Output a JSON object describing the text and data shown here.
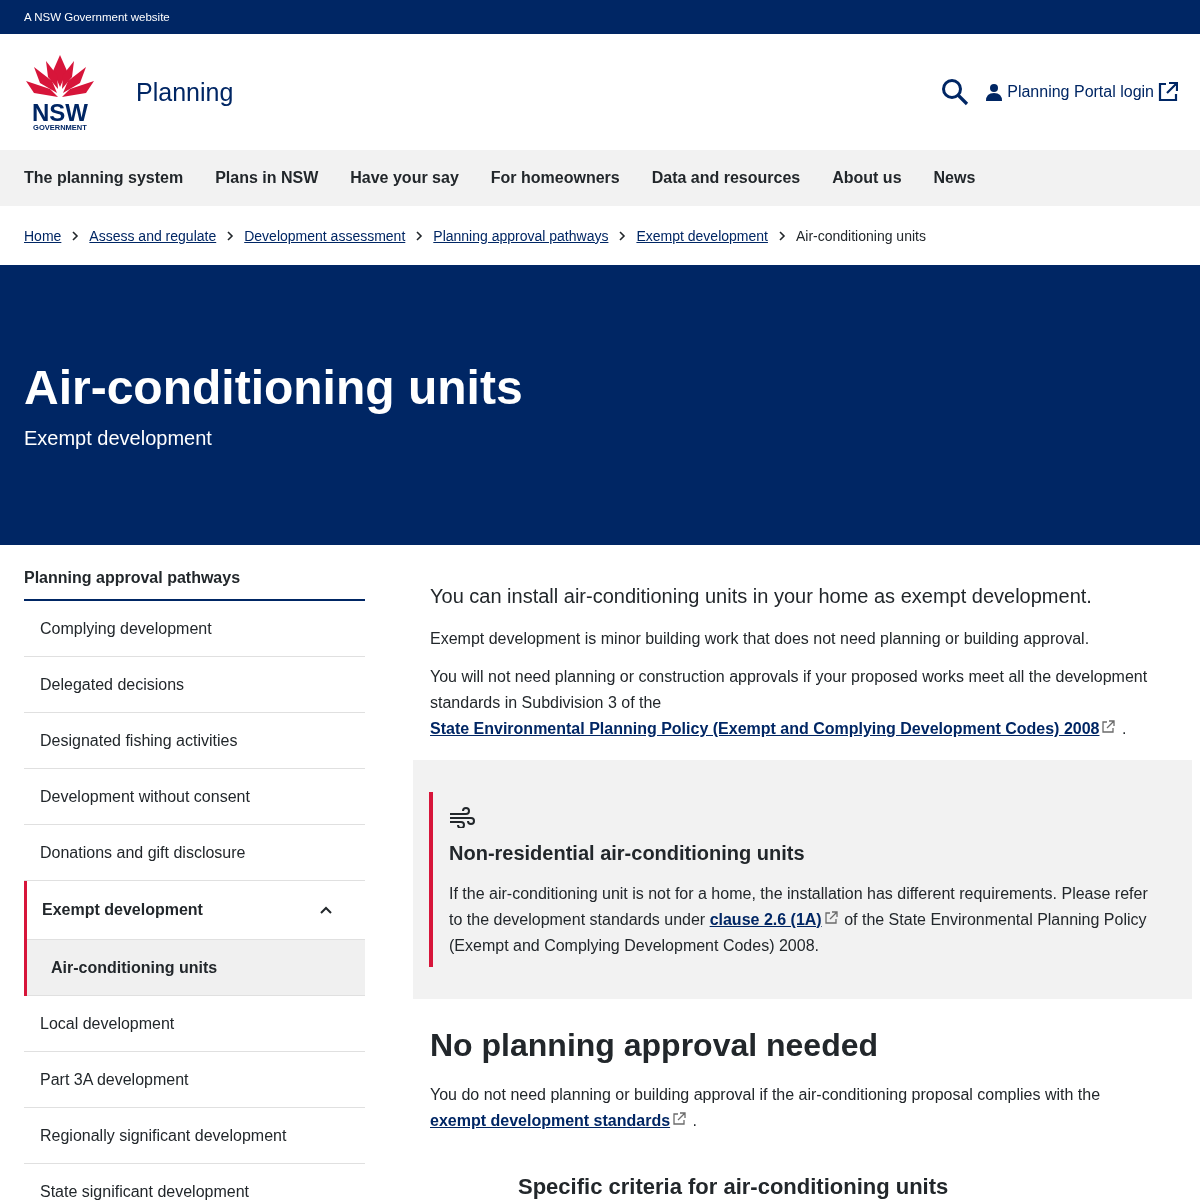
{
  "masthead": {
    "text": "A NSW Government website"
  },
  "header": {
    "logo_wordmark": "NSW",
    "logo_subtext": "GOVERNMENT",
    "site_title": "Planning",
    "login": "Planning Portal login"
  },
  "nav": {
    "items": [
      "The planning system",
      "Plans in NSW",
      "Have your say",
      "For homeowners",
      "Data and resources",
      "About us",
      "News"
    ]
  },
  "breadcrumb": {
    "links": [
      "Home",
      "Assess and regulate",
      "Development assessment",
      "Planning approval pathways",
      "Exempt development"
    ],
    "current": "Air-conditioning units"
  },
  "hero": {
    "title": "Air-conditioning units",
    "subtitle": "Exempt development"
  },
  "sidebar": {
    "title": "Planning approval pathways",
    "items": [
      {
        "label": "Complying development",
        "selected": false
      },
      {
        "label": "Delegated decisions",
        "selected": false
      },
      {
        "label": "Designated fishing activities",
        "selected": false
      },
      {
        "label": "Development without consent",
        "selected": false
      },
      {
        "label": "Donations and gift disclosure",
        "selected": false
      },
      {
        "label": "Exempt development",
        "selected": false,
        "expanded": true,
        "children": [
          {
            "label": "Air-conditioning units",
            "selected": true
          }
        ]
      },
      {
        "label": "Local development",
        "selected": false
      },
      {
        "label": "Part 3A development",
        "selected": false
      },
      {
        "label": "Regionally significant development",
        "selected": false
      },
      {
        "label": "State significant development",
        "selected": false
      }
    ]
  },
  "content": {
    "lead": "You can install air-conditioning units in your home as exempt development.",
    "paragraphs": [
      {
        "text": "Exempt development is minor building work that does not need planning or building approval."
      },
      {
        "text": "You will not need planning or construction approvals if your proposed works meet all the development standards in Subdivision 3 of the",
        "link": "State Environmental Planning Policy (Exempt and Complying Development Codes) 2008",
        "after": "."
      }
    ],
    "callout": {
      "title": "Non-residential air-conditioning units",
      "text": "If the air-conditioning unit is not for a home, the installation has different requirements. Please refer to the development standards under",
      "link": "clause 2.6 (1A)",
      "after": "of the State Environmental Planning Policy (Exempt and Complying Development Codes) 2008."
    },
    "section": {
      "heading": "No planning approval needed",
      "text": "You do not need planning or building approval if the air-conditioning proposal complies with the",
      "link": "exempt development standards",
      "after": "."
    },
    "subheading": "Specific criteria for air-conditioning units"
  }
}
